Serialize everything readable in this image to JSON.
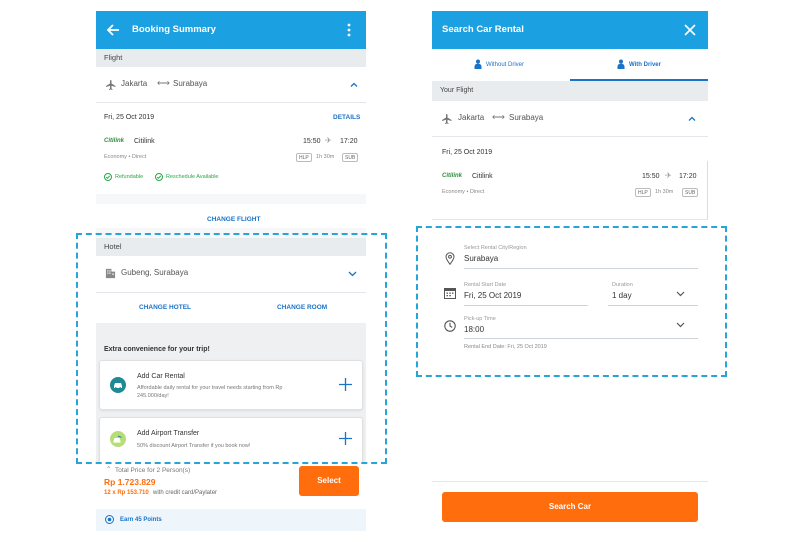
{
  "left": {
    "header": {
      "title": "Booking Summary"
    },
    "flight": {
      "section": "Flight",
      "origin": "Jakarta",
      "destination": "Surabaya",
      "date": "Fri, 25 Oct 2019",
      "details_link": "DETAILS",
      "airline_logo": "Citilink",
      "airline": "Citilink",
      "depart": "15:50",
      "arrive": "17:20",
      "class_info": "Economy • Direct",
      "from_code": "HLP",
      "duration": "1h 30m",
      "to_code": "SUB",
      "refundable": "Refundable",
      "reschedule": "Reschedule Available",
      "change_flight": "CHANGE FLIGHT"
    },
    "hotel": {
      "section": "Hotel",
      "location": "Gubeng, Surabaya",
      "change_hotel": "CHANGE HOTEL",
      "change_room": "CHANGE ROOM"
    },
    "extras": {
      "heading": "Extra convenience for your trip!",
      "car": {
        "title": "Add Car Rental",
        "desc1": "Affordable daily rental for your travel needs starting from Rp",
        "desc2": "245.000/day!"
      },
      "airport": {
        "title": "Add Airport Transfer",
        "desc": "50% discount Airport Transfer if you book now!"
      }
    },
    "footer": {
      "total_label": "Total Price for 2 Person(s)",
      "price": "Rp 1.723.829",
      "installment": "12 x Rp 153.710",
      "installment_suffix": "with credit card/Paylater",
      "select": "Select",
      "points": "Earn 45 Points"
    }
  },
  "right": {
    "header": {
      "title": "Search Car Rental"
    },
    "tabs": {
      "without": "Without Driver",
      "with": "With Driver"
    },
    "flight": {
      "section": "Your Flight",
      "origin": "Jakarta",
      "destination": "Surabaya",
      "date": "Fri, 25 Oct 2019",
      "airline_logo": "Citilink",
      "airline": "Citilink",
      "depart": "15:50",
      "arrive": "17:20",
      "class_info": "Economy • Direct",
      "from_code": "HLP",
      "duration": "1h 30m",
      "to_code": "SUB"
    },
    "form": {
      "city_label": "Select Rental City/Region",
      "city_value": "Surabaya",
      "start_label": "Rental Start Date",
      "start_value": "Fri, 25 Oct 2019",
      "duration_label": "Duration",
      "duration_value": "1 day",
      "pickup_label": "Pick-up Time",
      "pickup_value": "18:00",
      "end_date": "Rental End Date: Fri, 25 Oct 2019"
    },
    "search_button": "Search Car"
  },
  "colors": {
    "primary": "#1ba0e2",
    "accent": "#ff6d0c",
    "link": "#1a73c8",
    "success": "#27a845",
    "highlight": "#2aa3d8"
  }
}
